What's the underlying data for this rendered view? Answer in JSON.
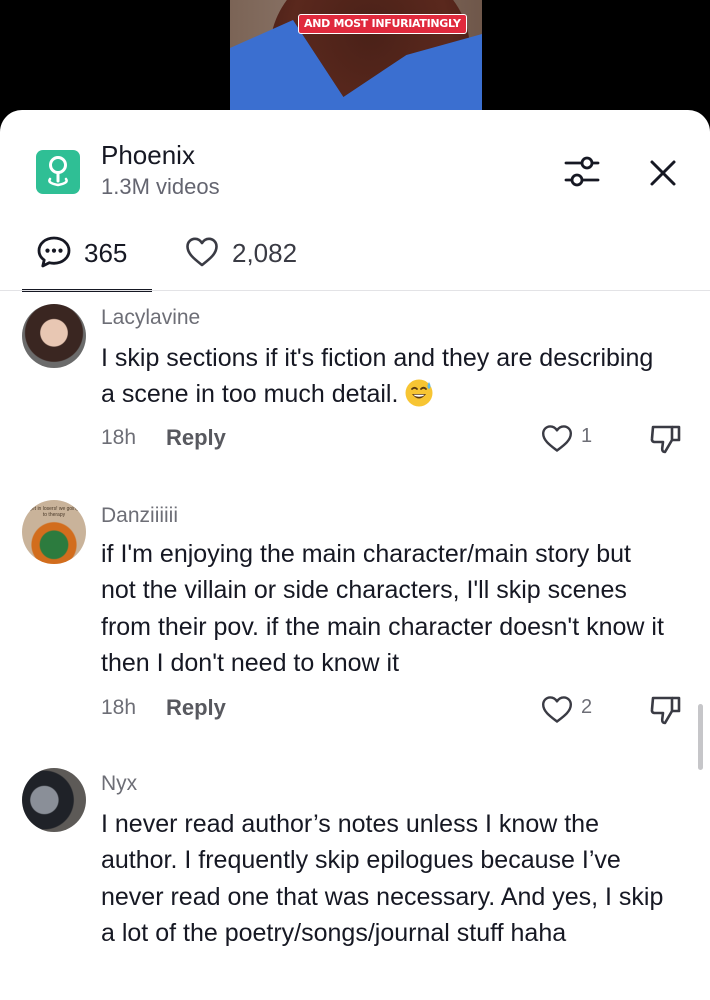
{
  "video": {
    "caption": "AND MOST INFURIATINGLY"
  },
  "header": {
    "title": "Phoenix",
    "subtitle": "1.3M videos",
    "place_icon": "location-pin-icon",
    "filter_icon": "sliders-icon",
    "close_icon": "close-icon"
  },
  "tabs": {
    "comments": {
      "icon": "comment-bubble-icon",
      "count": "365"
    },
    "likes": {
      "icon": "heart-icon",
      "count": "2,082"
    }
  },
  "colors": {
    "accent_green": "#2fbf95",
    "caption_red": "#e02a3d",
    "text_primary": "#161823",
    "text_secondary": "#6d6e76"
  },
  "comments": [
    {
      "username": "Lacylavine",
      "text": "I skip sections if it's fiction and they are describing a scene in too much detail.",
      "emoji": "sweat-smile-emoji-icon",
      "time": "18h",
      "reply_label": "Reply",
      "likes": "1"
    },
    {
      "username": "Danziiiiii",
      "avatar_text": "get in losers! we going to therapy",
      "text": "if I'm enjoying the main character/main story but not the villain or side characters, I'll skip scenes from their pov. if the main character doesn't know it then I don't need to know it",
      "time": "18h",
      "reply_label": "Reply",
      "likes": "2"
    },
    {
      "username": "Nyx",
      "text": "I never read author’s notes unless I know the author. I frequently skip epilogues because I’ve never read one that was necessary. And yes, I skip a lot of the poetry/songs/journal stuff haha"
    }
  ]
}
